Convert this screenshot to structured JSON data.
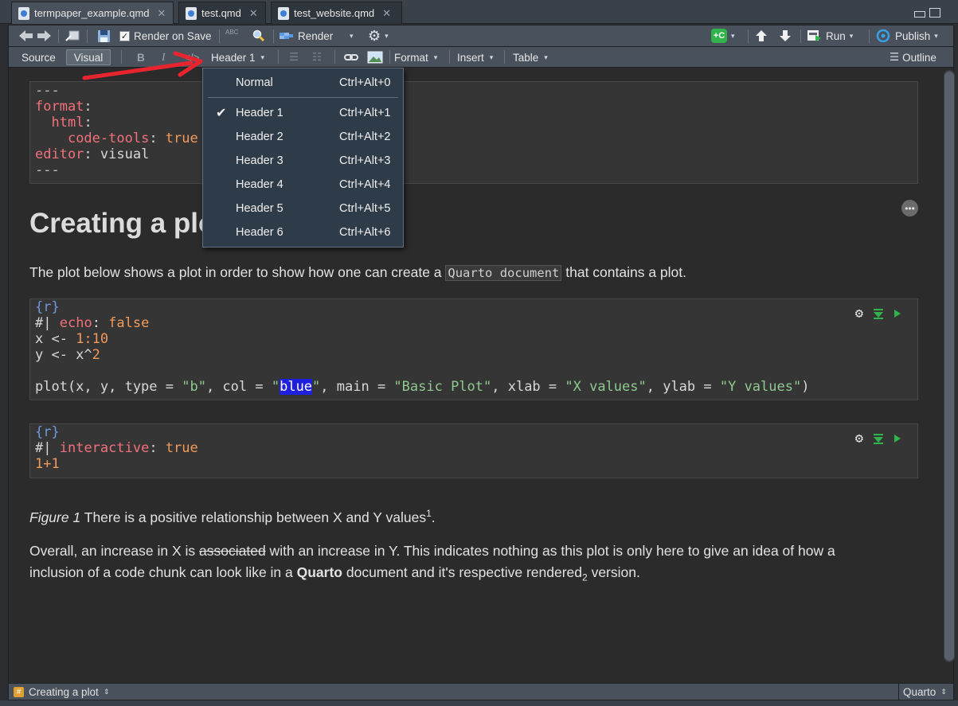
{
  "tabs": [
    {
      "label": "termpaper_example.qmd",
      "active": true
    },
    {
      "label": "test.qmd",
      "active": false
    },
    {
      "label": "test_website.qmd",
      "active": false
    }
  ],
  "toolbar": {
    "render_on_save": "Render on Save",
    "spell_abc": "ABC",
    "render": "Render",
    "run": "Run",
    "publish": "Publish"
  },
  "format_bar": {
    "source": "Source",
    "visual": "Visual",
    "bold": "B",
    "italic": "I",
    "header_select": "Header 1",
    "format": "Format",
    "insert": "Insert",
    "table": "Table",
    "outline": "Outline"
  },
  "yaml": {
    "dash_open": "---",
    "format_key": "format",
    "html_key": "html",
    "code_tools_key": "code-tools",
    "code_tools_val": "true",
    "editor_key": "editor",
    "editor_val": "visual",
    "dash_close": "---"
  },
  "heading": "Creating a plot",
  "para1": {
    "before": "The plot below shows a plot in order to show how one can create a ",
    "code": "Quarto document",
    "after": " that contains a plot."
  },
  "chunk1": {
    "header": "{r}",
    "opt_prefix": "#|",
    "opt_key": "echo",
    "opt_val": "false",
    "x_assign": "x <- ",
    "x_val": "1:10",
    "y_assign": "y <- x^",
    "y_val": "2",
    "plot_a": "plot(x, y, type = ",
    "plot_type": "\"b\"",
    "plot_b": ", col = ",
    "plot_col_q1": "\"",
    "plot_col": "blue",
    "plot_col_q2": "\"",
    "plot_c": ", main = ",
    "plot_main": "\"Basic Plot\"",
    "plot_d": ", xlab = ",
    "plot_xlab": "\"X values\"",
    "plot_e": ", ylab = ",
    "plot_ylab": "\"Y values\"",
    "plot_f": ")"
  },
  "chunk2": {
    "header": "{r}",
    "opt_prefix": "#|",
    "opt_key": "interactive",
    "opt_val": "true",
    "code": "1+1"
  },
  "caption": {
    "label": "Figure 1",
    "text": " There is a positive relationship between X and Y values",
    "sup": "1",
    "end": "."
  },
  "para2": {
    "a": "Overall, an increase in X is ",
    "strike": "associated",
    "b": " with an increase in Y. This indicates nothing as this plot is only here to give an idea of how a",
    "c": "inclusion of a code chunk can look like in a ",
    "bold": "Quarto",
    "d": " document and it's respective rendered",
    "sub": "2",
    "e": " version."
  },
  "dropdown": {
    "items": [
      {
        "label": "Normal",
        "shortcut": "Ctrl+Alt+0",
        "checked": false
      },
      {
        "label": "Header 1",
        "shortcut": "Ctrl+Alt+1",
        "checked": true
      },
      {
        "label": "Header 2",
        "shortcut": "Ctrl+Alt+2",
        "checked": false
      },
      {
        "label": "Header 3",
        "shortcut": "Ctrl+Alt+3",
        "checked": false
      },
      {
        "label": "Header 4",
        "shortcut": "Ctrl+Alt+4",
        "checked": false
      },
      {
        "label": "Header 5",
        "shortcut": "Ctrl+Alt+5",
        "checked": false
      },
      {
        "label": "Header 6",
        "shortcut": "Ctrl+Alt+6",
        "checked": false
      }
    ]
  },
  "status": {
    "section": "Creating a plot",
    "doc_type": "Quarto"
  },
  "colors": {
    "annotation_arrow": "#e8252f",
    "run_green": "#2fb34a",
    "publish_blue": "#3aa0e8"
  }
}
